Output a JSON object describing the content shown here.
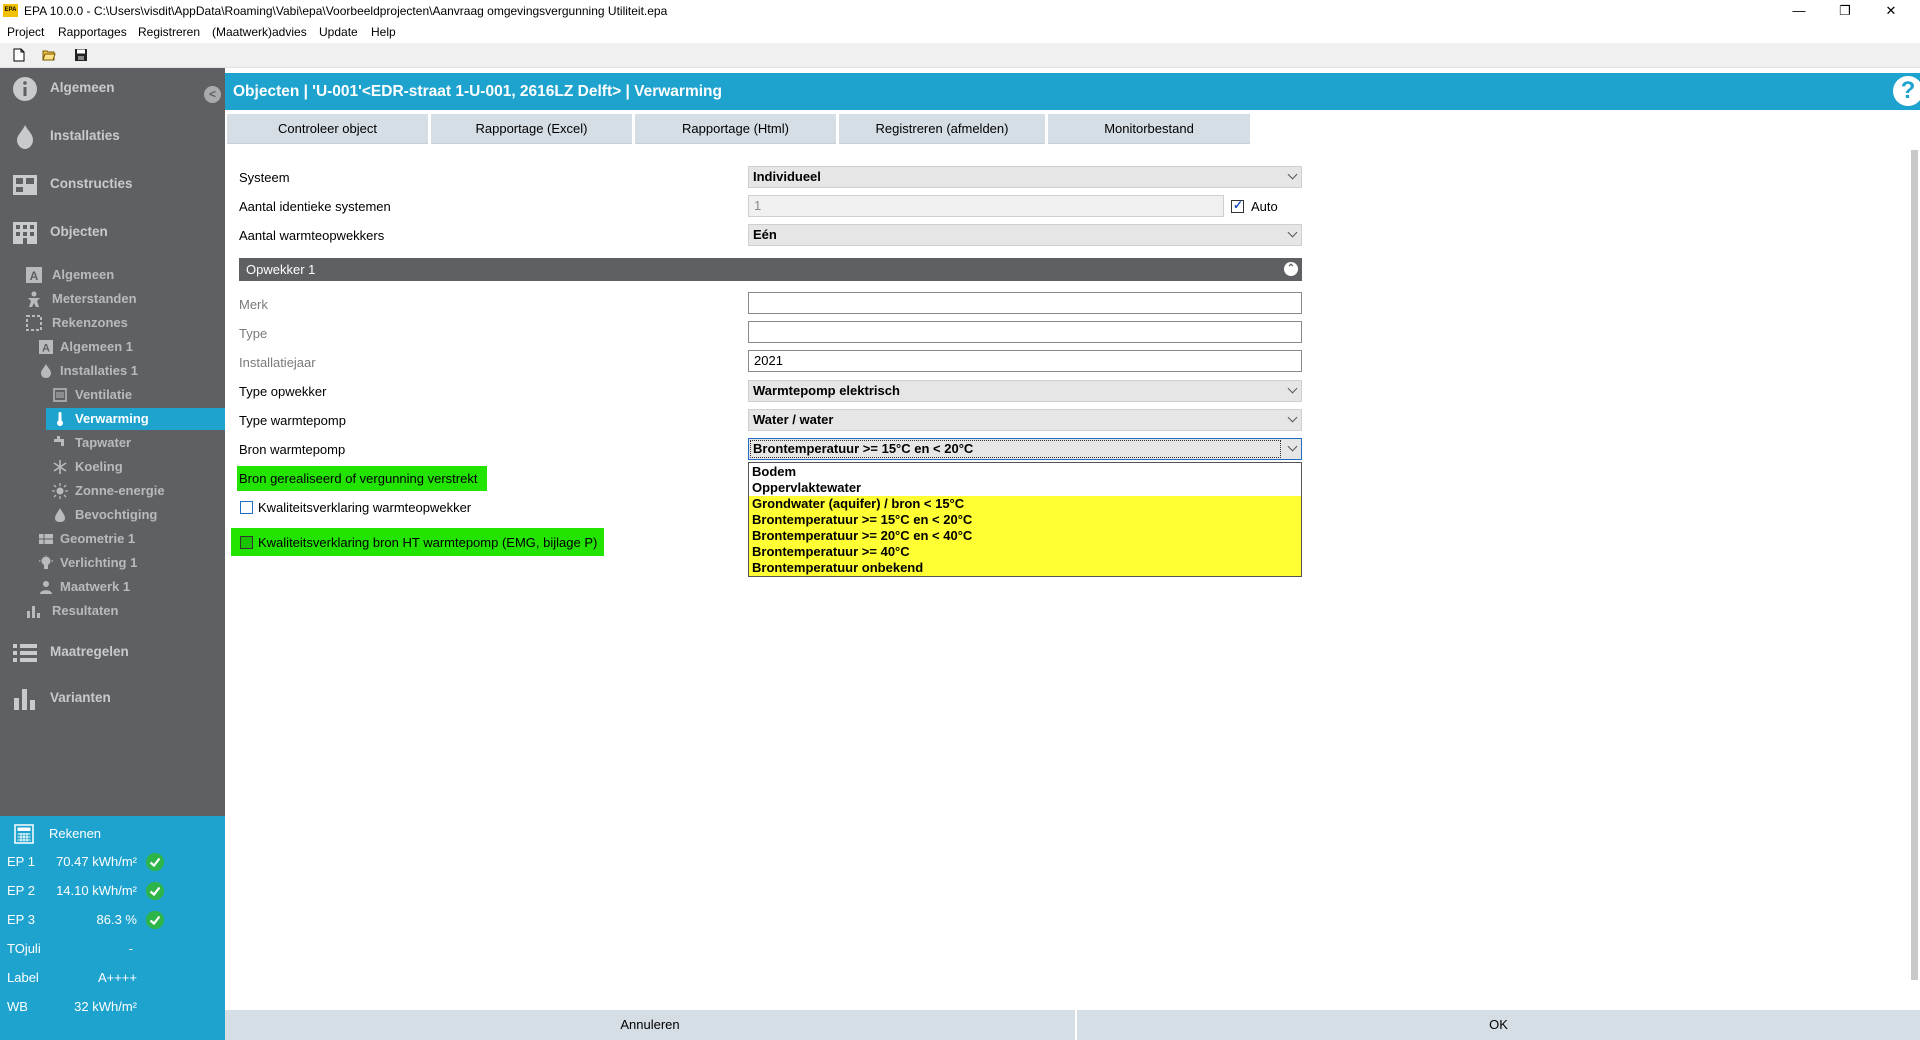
{
  "window": {
    "app_icon_text": "EPA",
    "title": "EPA 10.0.0 - C:\\Users\\visdit\\AppData\\Roaming\\Vabi\\epa\\Voorbeeldprojecten\\Aanvraag omgevingsvergunning Utiliteit.epa",
    "minimize": "—",
    "restore": "❐",
    "close": "✕"
  },
  "menu": [
    "Project",
    "Rapportages",
    "Registreren",
    "(Maatwerk)advies",
    "Update",
    "Help"
  ],
  "sidebar": {
    "collapse": "<",
    "main": {
      "algemeen": "Algemeen",
      "installaties": "Installaties",
      "constructies": "Constructies",
      "objecten": "Objecten",
      "maatregelen": "Maatregelen",
      "varianten": "Varianten"
    },
    "sub": {
      "algemeen": "Algemeen",
      "meterstanden": "Meterstanden",
      "rekenzones": "Rekenzones",
      "algemeen1": "Algemeen 1",
      "installaties1": "Installaties 1",
      "ventilatie": "Ventilatie",
      "verwarming": "Verwarming",
      "tapwater": "Tapwater",
      "koeling": "Koeling",
      "zonne_energie": "Zonne-energie",
      "bevochtiging": "Bevochtiging",
      "geometrie1": "Geometrie 1",
      "verlichting1": "Verlichting 1",
      "maatwerk1": "Maatwerk 1",
      "resultaten": "Resultaten"
    }
  },
  "results": {
    "title": "Rekenen",
    "rows": [
      {
        "key": "EP 1",
        "value": "70.47 kWh/m²"
      },
      {
        "key": "EP 2",
        "value": "14.10 kWh/m²"
      },
      {
        "key": "EP 3",
        "value": "86.3 %"
      },
      {
        "key": "TOjuli",
        "value": "-"
      },
      {
        "key": "Label",
        "value": "A++++"
      },
      {
        "key": "WB",
        "value": "32 kWh/m²"
      }
    ]
  },
  "header": {
    "title": "Objecten | 'U-001'<EDR-straat 1-U-001, 2616LZ Delft> | Verwarming",
    "help": "?"
  },
  "actions": [
    "Controleer object",
    "Rapportage (Excel)",
    "Rapportage (Html)",
    "Registreren (afmelden)",
    "Monitorbestand"
  ],
  "form": {
    "systeem_label": "Systeem",
    "systeem_value": "Individueel",
    "aantal_identiek_label": "Aantal identieke systemen",
    "aantal_identiek_value": "1",
    "auto_label": "Auto",
    "aantal_opwekkers_label": "Aantal warmteopwekkers",
    "aantal_opwekkers_value": "Eén",
    "section_title": "Opwekker 1",
    "merk_label": "Merk",
    "merk_value": "",
    "type_label": "Type",
    "type_value": "",
    "installatiejaar_label": "Installatiejaar",
    "installatiejaar_value": "2021",
    "type_opwekker_label": "Type opwekker",
    "type_opwekker_value": "Warmtepomp elektrisch",
    "type_wp_label": "Type warmtepomp",
    "type_wp_value": "Water / water",
    "bron_label": "Bron warmtepomp",
    "bron_value": "Brontemperatuur >= 15°C en < 20°C",
    "bron_gerealiseerd": "Bron gerealiseerd of vergunning verstrekt",
    "kwaliteit_opwekker": "Kwaliteitsverklaring warmteopwekker",
    "kwaliteit_bron": "Kwaliteitsverklaring bron HT warmtepomp (EMG, bijlage P)",
    "bron_options": [
      "Bodem",
      "Oppervlaktewater",
      "Grondwater (aquifer) / bron < 15°C",
      "Brontemperatuur >= 15°C en < 20°C",
      "Brontemperatuur >= 20°C en < 40°C",
      "Brontemperatuur >= 40°C",
      "Brontemperatuur onbekend"
    ]
  },
  "footer": {
    "cancel": "Annuleren",
    "ok": "OK"
  },
  "colors": {
    "accent": "#1ea3cf",
    "sidebar": "#5f6063",
    "highlight_yellow": "#ffff33",
    "highlight_green": "#22e400"
  }
}
